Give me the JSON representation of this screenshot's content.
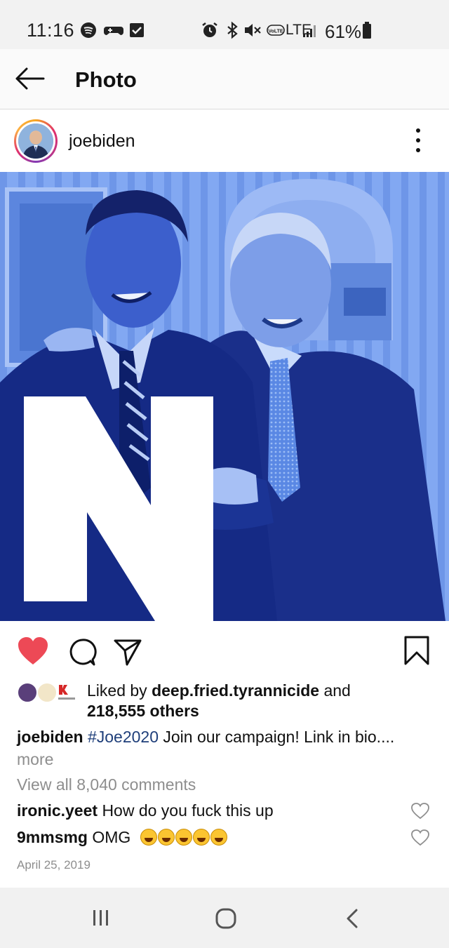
{
  "status_bar": {
    "time": "11:16",
    "lte_label": "LTE",
    "volte_label": "VoLTE",
    "battery_percent": "61%",
    "icons": [
      "spotify-icon",
      "game-controller-icon",
      "checkbox-icon",
      "alarm-icon",
      "bluetooth-icon",
      "mute-icon",
      "volte-icon",
      "lte-icon",
      "signal-icon",
      "battery-icon"
    ]
  },
  "app_bar": {
    "title": "Photo",
    "back_icon": "back-arrow-icon"
  },
  "post": {
    "username": "joebiden",
    "image_overlay_letter": "N",
    "actions": {
      "like_icon": "heart-filled-icon",
      "comment_icon": "comment-icon",
      "share_icon": "send-icon",
      "save_icon": "bookmark-icon",
      "like_color": "#ed4956"
    },
    "likes": {
      "prefix": "Liked by ",
      "liker": "deep.fried.tyrannicide",
      "joiner": " and",
      "others": "218,555 others"
    },
    "caption": {
      "user": "joebiden",
      "hashtag": "#Joe2020",
      "text": " Join our campaign! Link in bio....",
      "more": "more"
    },
    "view_all_comments": "View all 8,040 comments",
    "comments": [
      {
        "user": "ironic.yeet",
        "text": "How do you fuck this up"
      },
      {
        "user": "9mmsmg",
        "text": "OMG",
        "emoji_count": 5
      }
    ],
    "date": "April 25, 2019"
  },
  "nav_bar": {
    "recents_icon": "recents-icon",
    "home_icon": "home-icon",
    "back_icon": "nav-back-icon"
  },
  "colors": {
    "image_tint": "#5b86e3",
    "hashtag": "#1f3f7a",
    "muted_text": "#8e8e8e"
  }
}
